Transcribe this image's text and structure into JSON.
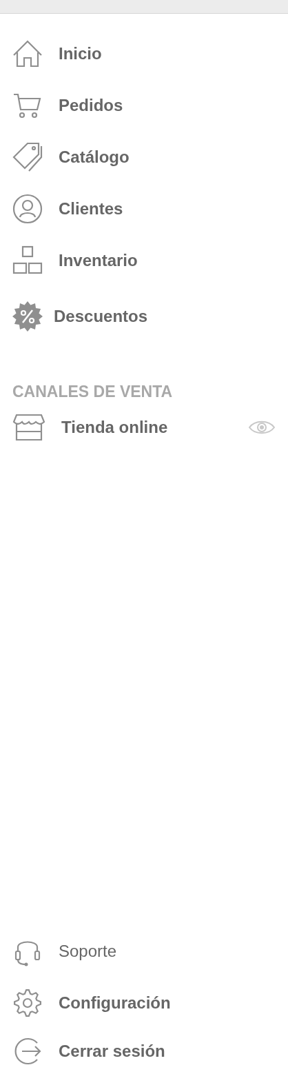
{
  "menu": {
    "items": [
      {
        "label": "Inicio",
        "bold": true
      },
      {
        "label": "Pedidos",
        "bold": true
      },
      {
        "label": "Catálogo",
        "bold": true
      },
      {
        "label": "Clientes",
        "bold": true
      },
      {
        "label": "Inventario",
        "bold": true
      },
      {
        "label": "Descuentos",
        "bold": true
      }
    ]
  },
  "sales_channels": {
    "heading": "CANALES DE VENTA",
    "items": [
      {
        "label": "Tienda online",
        "bold": true
      }
    ]
  },
  "footer": {
    "items": [
      {
        "label": "Soporte",
        "bold": false
      },
      {
        "label": "Configuración",
        "bold": true
      },
      {
        "label": "Cerrar sesión",
        "bold": true
      }
    ]
  }
}
